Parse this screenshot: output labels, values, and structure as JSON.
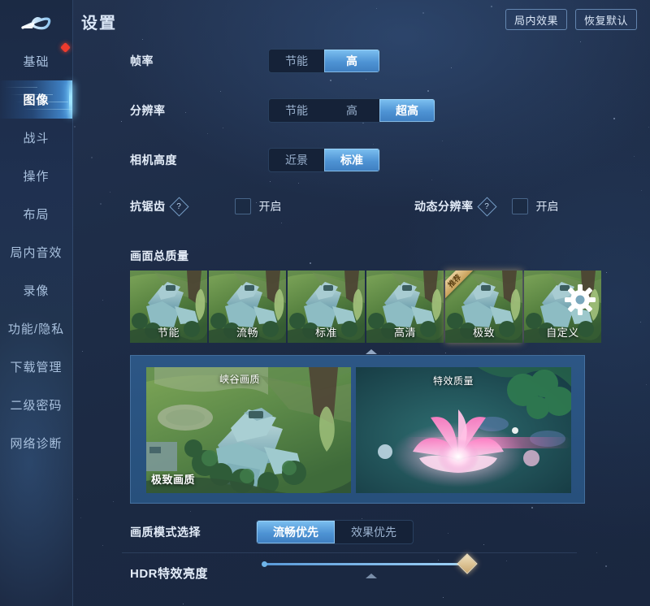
{
  "app": {
    "title": "设置",
    "back_icon": "back-arrow-icon"
  },
  "header": {
    "buttons": [
      {
        "label": "局内效果",
        "name": "in-game-effects-button"
      },
      {
        "label": "恢复默认",
        "name": "restore-defaults-button"
      }
    ]
  },
  "sidebar": {
    "items": [
      {
        "label": "基础",
        "active": false,
        "badge": true
      },
      {
        "label": "图像",
        "active": true,
        "badge": false
      },
      {
        "label": "战斗",
        "active": false,
        "badge": false
      },
      {
        "label": "操作",
        "active": false,
        "badge": false
      },
      {
        "label": "布局",
        "active": false,
        "badge": false
      },
      {
        "label": "局内音效",
        "active": false,
        "badge": false
      },
      {
        "label": "录像",
        "active": false,
        "badge": false
      },
      {
        "label": "功能/隐私",
        "active": false,
        "badge": false
      },
      {
        "label": "下载管理",
        "active": false,
        "badge": false
      },
      {
        "label": "二级密码",
        "active": false,
        "badge": false
      },
      {
        "label": "网络诊断",
        "active": false,
        "badge": false
      }
    ]
  },
  "settings": {
    "framerate": {
      "label": "帧率",
      "options": [
        "节能",
        "高"
      ],
      "selected": "高"
    },
    "resolution": {
      "label": "分辨率",
      "options": [
        "节能",
        "高",
        "超高"
      ],
      "selected": "超高"
    },
    "camera_height": {
      "label": "相机高度",
      "options": [
        "近景",
        "标准"
      ],
      "selected": "标准"
    },
    "antialiasing": {
      "label": "抗锯齿",
      "help_icon": "help-diamond-icon",
      "toggle_label": "开启",
      "checked": false
    },
    "dynamic_resolution": {
      "label": "动态分辨率",
      "help_icon": "help-diamond-icon",
      "toggle_label": "开启",
      "checked": false
    },
    "overall_quality": {
      "label": "画面总质量",
      "recommended_badge": "推荐",
      "selected": "极致",
      "presets": [
        {
          "label": "节能",
          "type": "scene",
          "recommended": false,
          "selected": false
        },
        {
          "label": "流畅",
          "type": "scene",
          "recommended": false,
          "selected": false
        },
        {
          "label": "标准",
          "type": "scene",
          "recommended": false,
          "selected": false
        },
        {
          "label": "高清",
          "type": "scene",
          "recommended": false,
          "selected": false
        },
        {
          "label": "极致",
          "type": "scene",
          "recommended": true,
          "selected": true
        },
        {
          "label": "自定义",
          "type": "custom",
          "recommended": false,
          "selected": false
        }
      ]
    },
    "preview": {
      "canyon": {
        "top_tag": "峡谷画质",
        "bottom_tag": "极致画质"
      },
      "effects": {
        "top_tag": "特效质量"
      }
    },
    "quality_mode": {
      "label": "画质模式选择",
      "options": [
        "流畅优先",
        "效果优先"
      ],
      "selected": "流畅优先"
    },
    "hdr_brightness": {
      "label": "HDR特效亮度",
      "value": 100,
      "min": 0,
      "max": 100
    }
  },
  "colors": {
    "accent": "#4e93d4",
    "accent_light": "#7cc0f0",
    "gold": "#d9b678",
    "badge_red": "#ef3b2d",
    "panel_blue": "#2c5685",
    "bg": "#1d2b45"
  }
}
